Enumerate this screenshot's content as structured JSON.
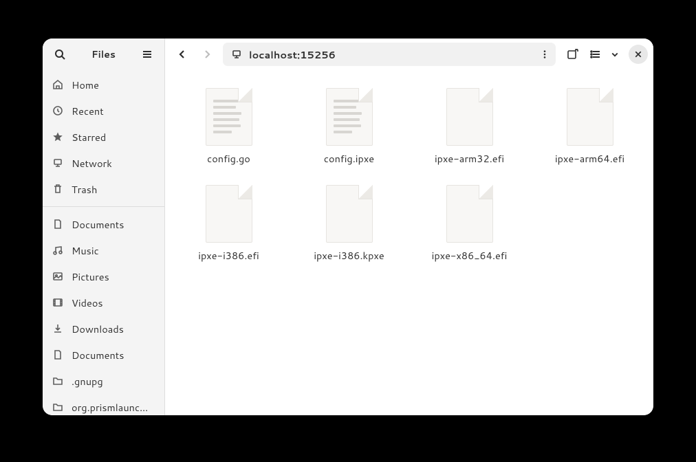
{
  "sidebar": {
    "title": "Files",
    "items": [
      {
        "label": "Home",
        "icon": "home"
      },
      {
        "label": "Recent",
        "icon": "clock"
      },
      {
        "label": "Starred",
        "icon": "star"
      },
      {
        "label": "Network",
        "icon": "network"
      },
      {
        "label": "Trash",
        "icon": "trash"
      }
    ],
    "bookmarks": [
      {
        "label": "Documents",
        "icon": "document"
      },
      {
        "label": "Music",
        "icon": "music"
      },
      {
        "label": "Pictures",
        "icon": "pictures"
      },
      {
        "label": "Videos",
        "icon": "videos"
      },
      {
        "label": "Downloads",
        "icon": "download"
      },
      {
        "label": "Documents",
        "icon": "document"
      },
      {
        "label": ".gnupg",
        "icon": "folder"
      },
      {
        "label": "org.prismlaunc…",
        "icon": "folder"
      }
    ]
  },
  "toolbar": {
    "address": "localhost:15256"
  },
  "files": [
    {
      "name": "config.go",
      "type": "text"
    },
    {
      "name": "config.ipxe",
      "type": "text"
    },
    {
      "name": "ipxe-arm32.efi",
      "type": "blank"
    },
    {
      "name": "ipxe-arm64.efi",
      "type": "blank"
    },
    {
      "name": "ipxe-i386.efi",
      "type": "blank"
    },
    {
      "name": "ipxe-i386.kpxe",
      "type": "blank"
    },
    {
      "name": "ipxe-x86_64.efi",
      "type": "blank"
    }
  ]
}
